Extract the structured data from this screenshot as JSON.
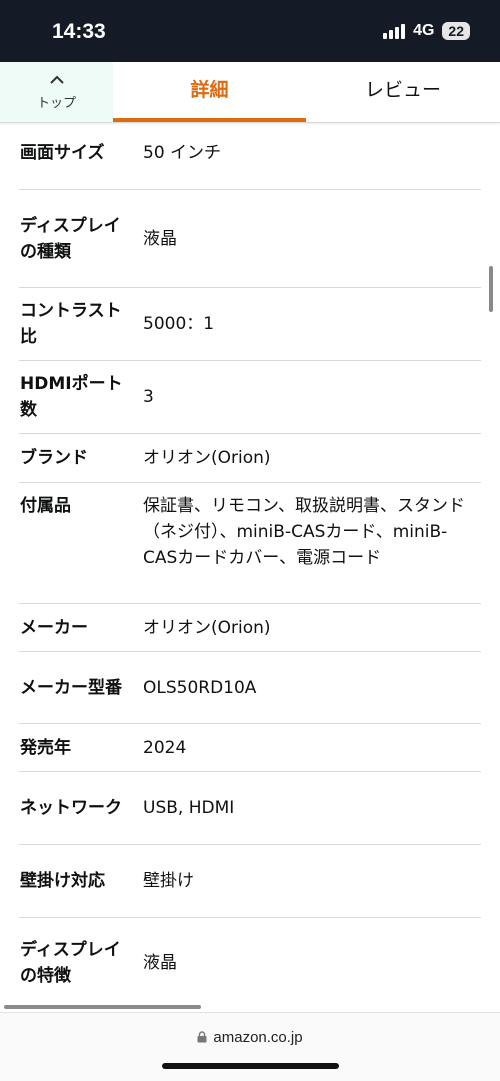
{
  "status": {
    "time": "14:33",
    "network": "4G",
    "battery": "22"
  },
  "tabs": {
    "top_label": "トップ",
    "detail_label": "詳細",
    "review_label": "レビュー"
  },
  "specs": [
    {
      "key": "画面サイズ",
      "value": "50 インチ"
    },
    {
      "key": "ディスプレイの種類",
      "value": "液晶"
    },
    {
      "key": "コントラスト比",
      "value": "5000：1"
    },
    {
      "key": "HDMIポート数",
      "value": "3"
    },
    {
      "key": "ブランド",
      "value": "オリオン(Orion)"
    },
    {
      "key": "付属品",
      "value": "保証書、リモコン、取扱説明書、スタンド（ネジ付）、miniB-CASカード、miniB-CASカードカバー、電源コード"
    },
    {
      "key": "メーカー",
      "value": "オリオン(Orion)"
    },
    {
      "key": "メーカー型番",
      "value": "OLS50RD10A"
    },
    {
      "key": "発売年",
      "value": "2024"
    },
    {
      "key": "ネットワーク",
      "value": "USB, HDMI"
    },
    {
      "key": "壁掛け対応",
      "value": "壁掛け"
    },
    {
      "key": "ディスプレイの特徴",
      "value": "液晶"
    }
  ],
  "browser": {
    "url": "amazon.co.jp"
  }
}
